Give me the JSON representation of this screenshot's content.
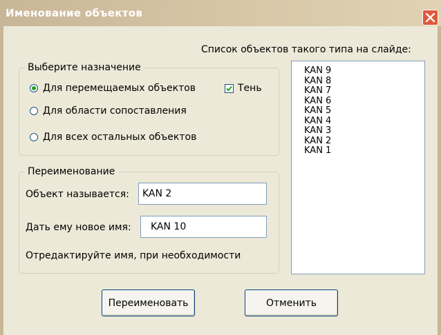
{
  "window": {
    "title": "Именование объектов",
    "close_icon": "close-x-icon"
  },
  "list": {
    "caption": "Список объектов такого типа на слайде:",
    "items": [
      "KAN 9",
      "KAN 8",
      "KAN 7",
      "KAN 6",
      "KAN 5",
      "KAN 4",
      "KAN 3",
      "KAN 2",
      "KAN 1"
    ]
  },
  "purpose": {
    "legend": "Выберите назначение",
    "option_movable": "Для перемещаемых объектов",
    "option_matching": "Для области сопоставления",
    "option_other": "Для всех остальных объектов",
    "selected": "option_movable",
    "shadow_label": "Тень",
    "shadow_checked": true
  },
  "rename": {
    "legend": "Переименование",
    "current_label": "Объект называется:",
    "current_value": "KAN 2",
    "new_label": "Дать ему новое имя:",
    "new_value": "KAN 10",
    "hint": "Отредактируйте имя, при необходимости"
  },
  "buttons": {
    "rename": "Переименовать",
    "cancel": "Отменить"
  },
  "colors": {
    "title_bar": "#c9b697",
    "close_button": "#e2573b",
    "dialog_bg": "#ece9d8",
    "radio_dot": "#21a121"
  }
}
